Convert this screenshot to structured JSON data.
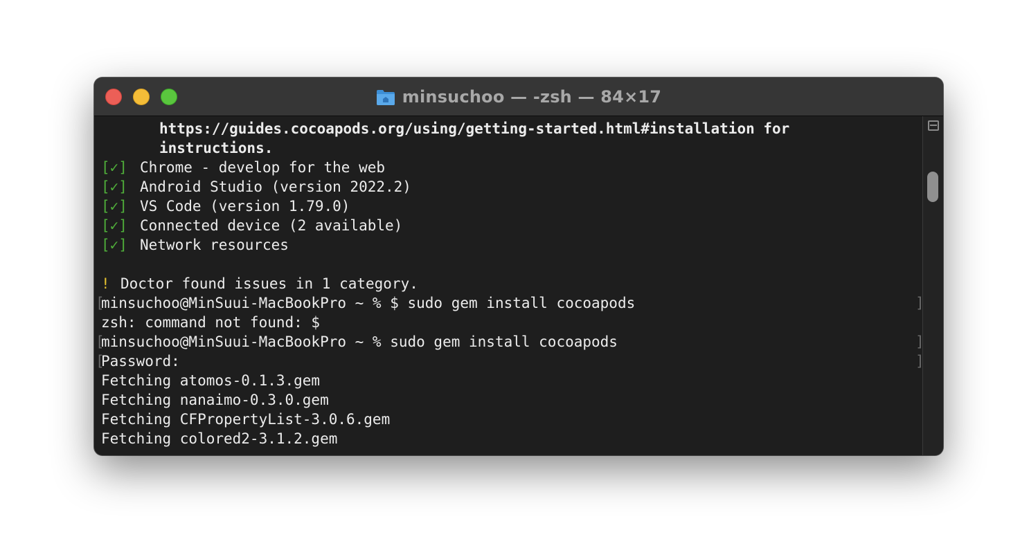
{
  "window": {
    "title": "minsuchoo — -zsh — 84×17",
    "folder_icon": "folder-icon",
    "colors": {
      "close": "#ec5f57",
      "minimize": "#f4bd38",
      "maximize": "#5ac63e",
      "check_green": "#4fae3a",
      "warning_yellow": "#e6c230"
    }
  },
  "terminal": {
    "lines": {
      "l0": "https://guides.cocoapods.org/using/getting-started.html#installation for",
      "l1": "instructions.",
      "l2_mark": "[✓]",
      "l2_text": "Chrome - develop for the web",
      "l3_mark": "[✓]",
      "l3_text": "Android Studio (version 2022.2)",
      "l4_mark": "[✓]",
      "l4_text": "VS Code (version 1.79.0)",
      "l5_mark": "[✓]",
      "l5_text": "Connected device (2 available)",
      "l6_mark": "[✓]",
      "l6_text": "Network resources",
      "l8_mark": "!",
      "l8_text": "Doctor found issues in 1 category.",
      "l9": "minsuchoo@MinSuui-MacBookPro ~ % $ sudo gem install cocoapods",
      "l10": "zsh: command not found: $",
      "l11": "minsuchoo@MinSuui-MacBookPro ~ % sudo gem install cocoapods",
      "l12": "Password:",
      "l13": "Fetching atomos-0.1.3.gem",
      "l14": "Fetching nanaimo-0.3.0.gem",
      "l15": "Fetching CFPropertyList-3.0.6.gem",
      "l16": "Fetching colored2-3.1.2.gem"
    },
    "mark_left": "[",
    "mark_right": "]"
  }
}
